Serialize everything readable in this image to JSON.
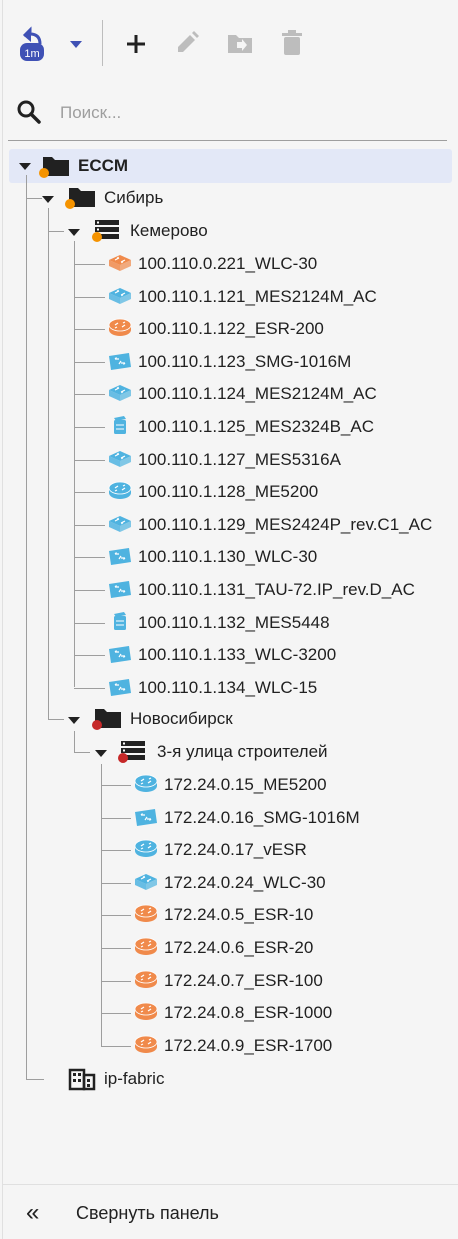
{
  "toolbar": {
    "refresh_badge": "1m",
    "buttons": [
      "refresh-icon",
      "chevron-down-icon",
      "add-icon",
      "edit-icon",
      "move-to-folder-icon",
      "delete-icon"
    ],
    "accent_color": "#3f51b5",
    "disabled_color": "#bdbdbd"
  },
  "search": {
    "placeholder": "Поиск..."
  },
  "tree": {
    "root": {
      "label": "ECCM",
      "status": "orange"
    },
    "siberia": {
      "label": "Сибирь",
      "status": "orange"
    },
    "kemerovo": {
      "label": "Кемерово",
      "status": "orange"
    },
    "kemerovo_devices": [
      {
        "label": "100.110.0.221_WLC-30",
        "icon": "orange-switch-icon"
      },
      {
        "label": "100.110.1.121_MES2124M_AC",
        "icon": "blue-switch-icon"
      },
      {
        "label": "100.110.1.122_ESR-200",
        "icon": "orange-router-icon"
      },
      {
        "label": "100.110.1.123_SMG-1016M",
        "icon": "blue-gateway-icon"
      },
      {
        "label": "100.110.1.124_MES2124M_AC",
        "icon": "blue-switch-icon"
      },
      {
        "label": "100.110.1.125_MES2324B_AC",
        "icon": "blue-stack-icon"
      },
      {
        "label": "100.110.1.127_MES5316A",
        "icon": "blue-switch-icon"
      },
      {
        "label": "100.110.1.128_ME5200",
        "icon": "blue-router-icon"
      },
      {
        "label": "100.110.1.129_MES2424P_rev.C1_AC",
        "icon": "blue-switch-icon"
      },
      {
        "label": "100.110.1.130_WLC-30",
        "icon": "blue-gateway-icon"
      },
      {
        "label": "100.110.1.131_TAU-72.IP_rev.D_AC",
        "icon": "blue-gateway-icon"
      },
      {
        "label": "100.110.1.132_MES5448",
        "icon": "blue-stack-icon"
      },
      {
        "label": "100.110.1.133_WLC-3200",
        "icon": "blue-gateway-icon"
      },
      {
        "label": "100.110.1.134_WLC-15",
        "icon": "blue-gateway-icon"
      }
    ],
    "novosibirsk": {
      "label": "Новосибирск",
      "status": "red"
    },
    "builders_street": {
      "label": "3-я улица строителей",
      "status": "red"
    },
    "novosibirsk_devices": [
      {
        "label": "172.24.0.15_ME5200",
        "icon": "blue-router-icon"
      },
      {
        "label": "172.24.0.16_SMG-1016M",
        "icon": "blue-gateway-icon"
      },
      {
        "label": "172.24.0.17_vESR",
        "icon": "blue-router-icon"
      },
      {
        "label": "172.24.0.24_WLC-30",
        "icon": "blue-switch-icon"
      },
      {
        "label": "172.24.0.5_ESR-10",
        "icon": "orange-router-icon"
      },
      {
        "label": "172.24.0.6_ESR-20",
        "icon": "orange-router-icon"
      },
      {
        "label": "172.24.0.7_ESR-100",
        "icon": "orange-router-icon"
      },
      {
        "label": "172.24.0.8_ESR-1000",
        "icon": "orange-router-icon"
      },
      {
        "label": "172.24.0.9_ESR-1700",
        "icon": "orange-router-icon"
      }
    ],
    "ip_fabric": {
      "label": "ip-fabric"
    }
  },
  "status_colors": {
    "orange": "#f59300",
    "red": "#c62828"
  },
  "device_colors": {
    "blue": "#4fb3e0",
    "orange": "#f08a4b"
  },
  "footer": {
    "collapse_icon": "«",
    "collapse_label": "Свернуть панель"
  }
}
